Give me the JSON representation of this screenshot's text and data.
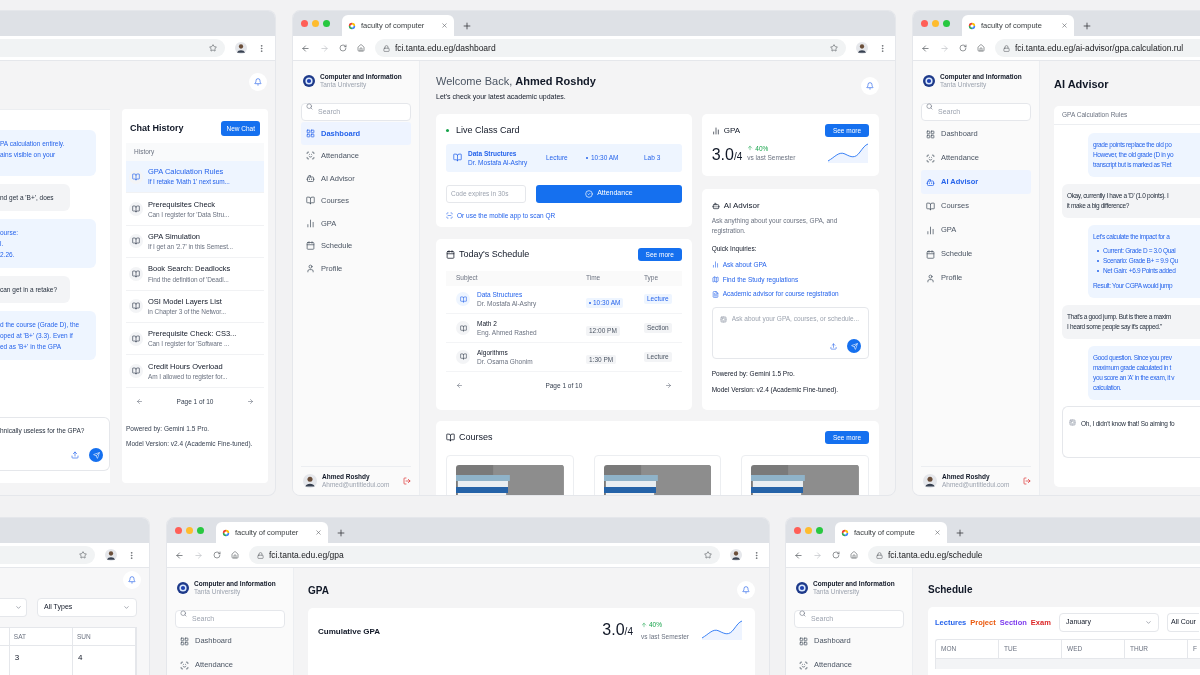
{
  "chat_window": {
    "messages": [
      {
        "kind": "assistant",
        "lines": [
          "PA calculation entirely.",
          "ains visible on your"
        ]
      },
      {
        "kind": "user",
        "lines": [
          "nd get a 'B+', does"
        ]
      },
      {
        "kind": "assistant",
        "lines": [
          "ourse:",
          "l.",
          "2.26."
        ]
      },
      {
        "kind": "user",
        "lines": [
          "can get in a retake?"
        ]
      },
      {
        "kind": "assistant",
        "lines": [
          "d the course (Grade D), the",
          "oped at 'B+' (3.3). Even if",
          "ed as 'B+' in the GPA"
        ]
      }
    ],
    "input_text": "hnically useless for the GPA?",
    "history": {
      "title": "Chat History",
      "new_button": "New Chat",
      "section_label": "History",
      "items": [
        {
          "title": "GPA Calculation Rules",
          "preview": "If I retake 'Math 1' next sum...",
          "selected": true
        },
        {
          "title": "Prerequisites Check",
          "preview": "Can I register for 'Data Stru...",
          "selected": false
        },
        {
          "title": "GPA Simulation",
          "preview": "If I get an '2.7' in this Semest...",
          "selected": false
        },
        {
          "title": "Book Search: Deadlocks",
          "preview": "Find the definition of 'Deadl...",
          "selected": false
        },
        {
          "title": "OSI Model Layers List",
          "preview": "in Chapter 3 of the Networ...",
          "selected": false
        },
        {
          "title": "Prerequisite Check: CS3...",
          "preview": "Can I register for 'Software ...",
          "selected": false
        },
        {
          "title": "Credit Hours Overload",
          "preview": "Am I allowed to register for...",
          "selected": false
        }
      ],
      "pagination": "Page 1 of 10",
      "powered_by": "Powered by: Gemini 1.5 Pro.",
      "model_version": "Model Version: v2.4 (Academic Fine-tuned)."
    }
  },
  "dashboard_window": {
    "tab_title": "faculty of computer",
    "url": "fci.tanta.edu.eg/dashboard",
    "sidebar": {
      "title": "Computer and Information",
      "subtitle": "Tanta University",
      "search_placeholder": "Search",
      "nav": [
        {
          "label": "Dashboard",
          "selected": true
        },
        {
          "label": "Attendance",
          "selected": false
        },
        {
          "label": "AI Advisor",
          "selected": false
        },
        {
          "label": "Courses",
          "selected": false
        },
        {
          "label": "GPA",
          "selected": false
        },
        {
          "label": "Schedule",
          "selected": false
        },
        {
          "label": "Profile",
          "selected": false
        }
      ],
      "user": {
        "name": "Ahmed Roshdy",
        "email": "Ahmed@untitledui.com"
      }
    },
    "greeting": "Welcome Back, **Ahmed Roshdy**",
    "subtitle": "Let's check your latest academic updates.",
    "live_class": {
      "title": "Live Class Card",
      "course": "Data Structures",
      "instructor": "Dr. Mostafa Al-Ashry",
      "type": "Lecture",
      "time": "10:30 AM",
      "room": "Lab 3",
      "code_placeholder": "Code expires in 30s",
      "button": "Attendance",
      "qr_link": "Or use the mobile app to scan QR"
    },
    "schedule": {
      "title": "Today's Schedule",
      "button": "See more",
      "columns": [
        "Subject",
        "Time",
        "Type"
      ],
      "rows": [
        {
          "subject": "Data Structures",
          "instructor": "Dr. Mostafa Al-Ashry",
          "time": "10:30 AM",
          "type": "Lecture",
          "selected": true
        },
        {
          "subject": "Math 2",
          "instructor": "Eng. Ahmed Rashed",
          "time": "12:00 PM",
          "type": "Section",
          "selected": false
        },
        {
          "subject": "Algorithms",
          "instructor": "Dr. Osama Ghonim",
          "time": "1:30 PM",
          "type": "Lecture",
          "selected": false
        }
      ],
      "pagination": "Page 1 of 10"
    },
    "gpa": {
      "title": "GPA",
      "button": "See more",
      "value": "3.0",
      "scale": "/4",
      "change": "40%",
      "comparison": "vs last Semester"
    },
    "advisor": {
      "title": "AI Advisor",
      "description": "Ask anything about your courses, GPA, and registration.",
      "quick_label": "Quick Inquiries:",
      "quick_links": [
        "Ask about GPA",
        "Find the Study regulations",
        "Academic advisor for course registration"
      ],
      "input_placeholder": "Ask about your GPA, courses, or schedule...",
      "powered_by": "Powered by: Gemini 1.5 Pro.",
      "model_version": "Model Version: v2.4 (Academic Fine-tuned)."
    },
    "courses": {
      "title": "Courses",
      "button": "See more"
    }
  },
  "advisor_window": {
    "tab_title": "faculty of compute",
    "url": "fci.tanta.edu.eg/ai-advisor/gpa.calculation.rul",
    "sidebar": {
      "title": "Computer and Information",
      "subtitle": "Tanta University",
      "search_placeholder": "Search",
      "nav": [
        {
          "label": "Dashboard",
          "selected": false
        },
        {
          "label": "Attendance",
          "selected": false
        },
        {
          "label": "AI Advisor",
          "selected": true
        },
        {
          "label": "Courses",
          "selected": false
        },
        {
          "label": "GPA",
          "selected": false
        },
        {
          "label": "Schedule",
          "selected": false
        },
        {
          "label": "Profile",
          "selected": false
        }
      ],
      "user": {
        "name": "Ahmed Roshdy",
        "email": "Ahmed@untitledui.com"
      }
    },
    "title": "AI Advisor",
    "chat_title": "GPA Calculation Rules",
    "messages": [
      {
        "kind": "assistant",
        "lines": [
          "grade points replace the old po",
          "However, the old grade (D in yo",
          "transcript but is marked as 'Ret"
        ]
      },
      {
        "kind": "user",
        "lines": [
          "Okay, currently I have a 'D' (1.0 points). I",
          "it make a big difference?"
        ]
      },
      {
        "kind": "assistant",
        "lines": [
          "Let's calculate the impact for a"
        ],
        "bullets": [
          "Current: Grade D = 3.0 Qual",
          "Scenario: Grade B+ = 9.9 Qu",
          "Net Gain: +6.9 Points added"
        ],
        "result": "Result: Your CGPA would jump"
      },
      {
        "kind": "user",
        "lines": [
          "That's a good jump. But is there a maxim",
          "I heard some people say it's capped.\""
        ]
      },
      {
        "kind": "assistant",
        "lines": [
          "Good question. Since you prev",
          "maximum grade calculated in t",
          "you score an 'A' in the exam, it v",
          "calculation."
        ]
      }
    ],
    "input_text": "Oh, I didn't know that! So aiming fo"
  },
  "calendar_window": {
    "type_filter": "All Types",
    "columns": [
      "SAT",
      "SUN"
    ],
    "dates": [
      "3",
      "4"
    ]
  },
  "gpa_window": {
    "tab_title": "faculty of computer",
    "url": "fci.tanta.edu.eg/gpa",
    "sidebar": {
      "title": "Computer and Information",
      "subtitle": "Tanta University",
      "search_placeholder": "Search",
      "nav": [
        {
          "label": "Dashboard",
          "selected": false
        },
        {
          "label": "Attendance",
          "selected": false
        }
      ]
    },
    "title": "GPA",
    "card_title": "Cumulative GPA",
    "value": "3.0",
    "scale": "/4",
    "change": "40%",
    "comparison": "vs last Semester"
  },
  "schedule_window": {
    "tab_title": "faculty of compute",
    "url": "fci.tanta.edu.eg/schedule",
    "sidebar": {
      "title": "Computer and Information",
      "subtitle": "Tanta University",
      "search_placeholder": "Search",
      "nav": [
        {
          "label": "Dashboard",
          "selected": false
        },
        {
          "label": "Attendance",
          "selected": false
        }
      ]
    },
    "title": "Schedule",
    "legend": [
      {
        "label": "Lectures",
        "color": "#2563eb"
      },
      {
        "label": "Project",
        "color": "#ea580c"
      },
      {
        "label": "Section",
        "color": "#7c3aed"
      },
      {
        "label": "Exam",
        "color": "#dc2626"
      }
    ],
    "month": "January",
    "course_filter": "All Cour",
    "columns": [
      "MON",
      "TUE",
      "WED",
      "THUR",
      "F"
    ]
  }
}
